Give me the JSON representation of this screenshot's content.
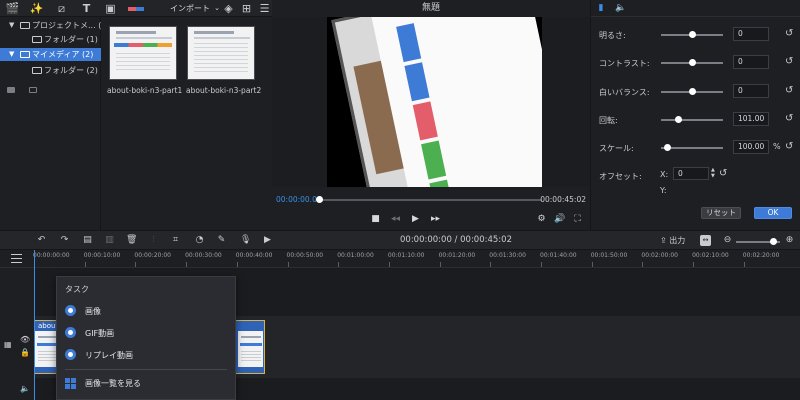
{
  "toolbar": {
    "import_label": "インポート"
  },
  "tree": {
    "items": [
      {
        "label": "プロジェクトメ...",
        "count": "(1)"
      },
      {
        "label": "フォルダー",
        "count": "(1)"
      },
      {
        "label": "マイメディア",
        "count": "(2)"
      },
      {
        "label": "フォルダー",
        "count": "(2)"
      }
    ]
  },
  "media": {
    "items": [
      {
        "label": "about-boki-n3-part1"
      },
      {
        "label": "about-boki-n3-part2"
      }
    ]
  },
  "preview": {
    "title": "無題",
    "current_time": "00:00:00.00",
    "total_time": "00:00:45:02",
    "progress": 0.0
  },
  "properties": {
    "rows": [
      {
        "label": "明るさ:",
        "value": "0",
        "unit": "",
        "level": 0.5
      },
      {
        "label": "コントラスト:",
        "value": "0",
        "unit": "",
        "level": 0.5
      },
      {
        "label": "白いバランス:",
        "value": "0",
        "unit": "",
        "level": 0.5
      },
      {
        "label": "回転:",
        "value": "101.00",
        "unit": "",
        "level": 0.28
      },
      {
        "label": "スケール:",
        "value": "100.00",
        "unit": "%",
        "level": 0.1
      }
    ],
    "offset_label": "オフセット:",
    "offset_x_label": "X:",
    "offset_y_label": "Y:",
    "offset_x_value": "0",
    "reset_label": "リセット",
    "ok_label": "OK"
  },
  "timeline": {
    "time_display": "00:00:00:00 / 00:00:45:02",
    "output_label": "出力",
    "ruler": [
      "00:00:00:00",
      "00:00:10:00",
      "00:00:20:00",
      "00:00:30:00",
      "00:00:40:00",
      "00:00:50:00",
      "00:01:00:00",
      "00:01:10:00",
      "00:01:20:00",
      "00:01:30:00",
      "00:01:40:00",
      "00:01:50:00",
      "00:02:00:00",
      "00:02:10:00",
      "00:02:20:00"
    ],
    "clip_label": "about..."
  },
  "context_menu": {
    "header": "タスク",
    "items": [
      {
        "label": "画像"
      },
      {
        "label": "GIF動画"
      },
      {
        "label": "リプレイ動画"
      }
    ],
    "grid_item": "画像一覧を見る"
  },
  "colors": {
    "accent": "#3d7bd6",
    "background": "#1e1f22",
    "clip_border": "#d7b24a"
  }
}
